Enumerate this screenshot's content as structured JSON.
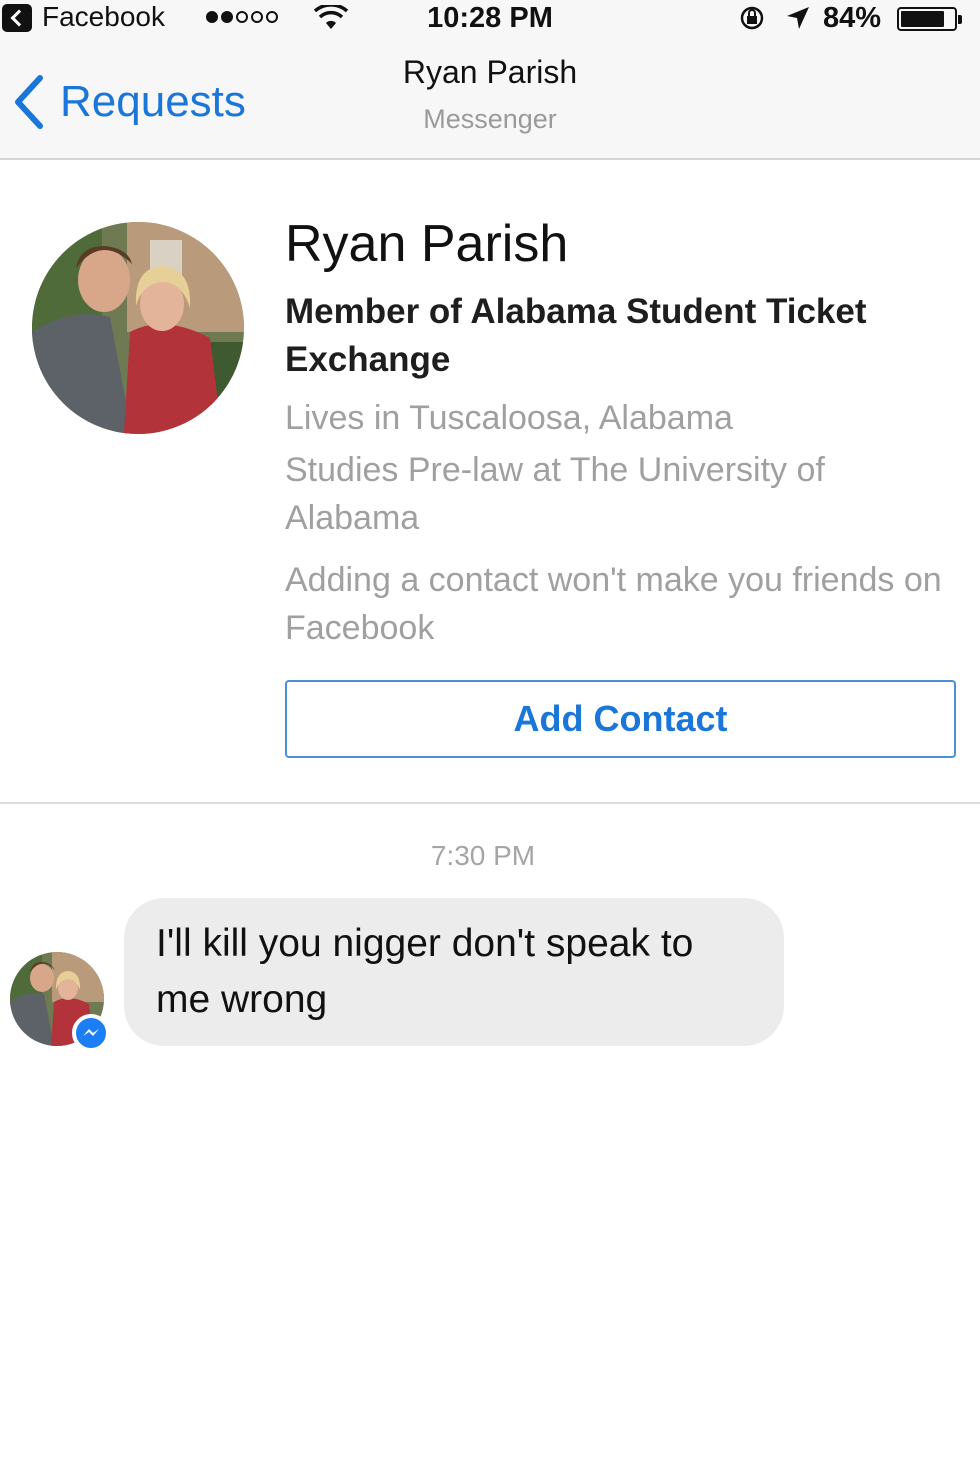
{
  "status_bar": {
    "app_name": "Facebook",
    "signal_dots": [
      true,
      true,
      false,
      false,
      false
    ],
    "time": "10:28 PM",
    "battery_percent": "84%",
    "battery_level": 0.84,
    "icons": [
      "back-to-app-icon",
      "signal-dots-icon",
      "wifi-icon",
      "orientation-lock-icon",
      "location-arrow-icon",
      "battery-icon"
    ]
  },
  "nav": {
    "back_label": "Requests",
    "title": "Ryan Parish",
    "subtitle": "Messenger"
  },
  "profile": {
    "name": "Ryan Parish",
    "work": "Member of Alabama Student Ticket Exchange",
    "lives": "Lives in Tuscaloosa, Alabama",
    "studies": "Studies Pre-law at The University of Alabama",
    "note": "Adding a contact won't make you friends on Facebook",
    "add_contact_label": "Add Contact"
  },
  "conversation": {
    "timestamp": "7:30 PM",
    "messages": [
      {
        "from": "Ryan Parish",
        "text": "I'll kill you nigger don't speak to me wrong"
      }
    ]
  },
  "colors": {
    "accent": "#1a76d8",
    "bar_background": "#f7f7f7",
    "bubble_background": "#ececec",
    "muted_text": "#a0a0a0",
    "messenger_badge": "#1c7ef5"
  }
}
